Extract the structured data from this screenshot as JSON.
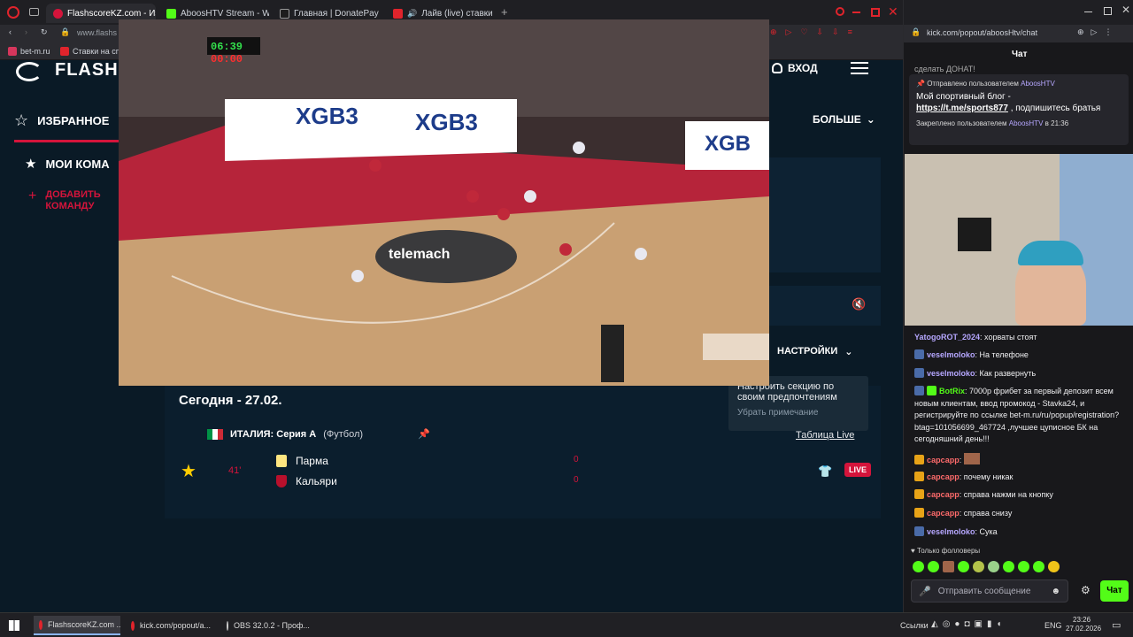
{
  "left_browser": {
    "tabs": [
      {
        "label": "FlashscoreKZ.com - Избр",
        "active": true,
        "color": "#d4143b"
      },
      {
        "label": "AboosHTV Stream - Watc",
        "active": false,
        "color": "#53fc18"
      },
      {
        "label": "Главная | DonatePay",
        "active": false,
        "color": "#1d1d1d"
      },
      {
        "label": "Лайв (live) ставки на",
        "active": false,
        "color": "#e0242c"
      }
    ],
    "url": "www.flashs",
    "bookmarks": [
      {
        "label": "bet-m.ru"
      },
      {
        "label": "Ставки на сп"
      }
    ],
    "scoreboard_time": "06:39",
    "scoreboard_shot": "00:00"
  },
  "site": {
    "logo": "FLASH",
    "login_label": "ВХОД",
    "favorites_label": "ИЗБРАННОЕ",
    "my_teams_label": "МОИ КОМА",
    "add_team_label": "ДОБАВИТЬ КОМАНДУ",
    "more_label": "БОЛЬШЕ",
    "settings_label": "НАСТРОЙКИ",
    "tooltip_title": "Настроить секцию по своим предпочтениям",
    "tooltip_remove": "Убрать примечание",
    "date_label": "Сегодня - 27.02.",
    "league": {
      "name": "ИТАЛИЯ: Серия А",
      "sport": "(Футбол)",
      "table_label": "Таблица Live"
    },
    "match": {
      "minute": "41'",
      "home": "Парма",
      "away": "Кальяри",
      "home_score": "0",
      "away_score": "0",
      "live_label": "LIVE"
    }
  },
  "right_browser": {
    "url": "kick.com/popout/aboosHtv/chat",
    "chat_title": "Чат",
    "top_line": "сделать ДОНАТ!",
    "pinned_by": "Отправлено пользователем",
    "pinned_user": "AboosHTV",
    "pinned_text": "Мой спортивный блог -",
    "pinned_link": "https://t.me/sports877",
    "pinned_text2": ", подпишитесь братья",
    "pinned_footer": "Закреплено пользователем",
    "pinned_footer_user": "AboosHTV",
    "pinned_time": "в 21:36",
    "messages": [
      {
        "user": "YatogoROT_2024",
        "text": "хорваты стоят",
        "color": "#b6a7ff"
      },
      {
        "user": "veselmoloko",
        "text": "На телефоне",
        "color": "#b6a7ff"
      },
      {
        "user": "veselmoloko",
        "text": "Как развернуть",
        "color": "#b6a7ff"
      },
      {
        "user": "BotRix",
        "text": "7000р фрибет за первый депозит всем новым клиентам, ввод промокод - Stavka24, и регистрируйте по ссылке bet-m.ru/ru/popup/registration?btag=101056699_467724 ,лучшее цуписное БК на сегодняшний день!!!",
        "color": "#53fc18"
      },
      {
        "user": "сарсарр",
        "text": "",
        "color": "#ff6b6b"
      },
      {
        "user": "сарсарр",
        "text": "почему никак",
        "color": "#ff6b6b"
      },
      {
        "user": "сарсарр",
        "text": "справа нажми на кнопку",
        "color": "#ff6b6b"
      },
      {
        "user": "сарсарр",
        "text": "справа снизу",
        "color": "#ff6b6b"
      },
      {
        "user": "veselmoloko",
        "text": "Сука",
        "color": "#b6a7ff"
      }
    ],
    "followers_only": "Только фолловеры",
    "input_placeholder": "Отправить сообщение",
    "chat_button": "Чат"
  },
  "taskbar": {
    "items": [
      {
        "label": "FlashscoreKZ.com ...",
        "active": true
      },
      {
        "label": "kick.com/popout/a...",
        "active": false
      },
      {
        "label": "OBS 32.0.2 - Проф...",
        "active": false
      }
    ],
    "links_label": "Ссылки",
    "lang": "ENG",
    "time": "23:26",
    "date": "27.02.2026"
  }
}
